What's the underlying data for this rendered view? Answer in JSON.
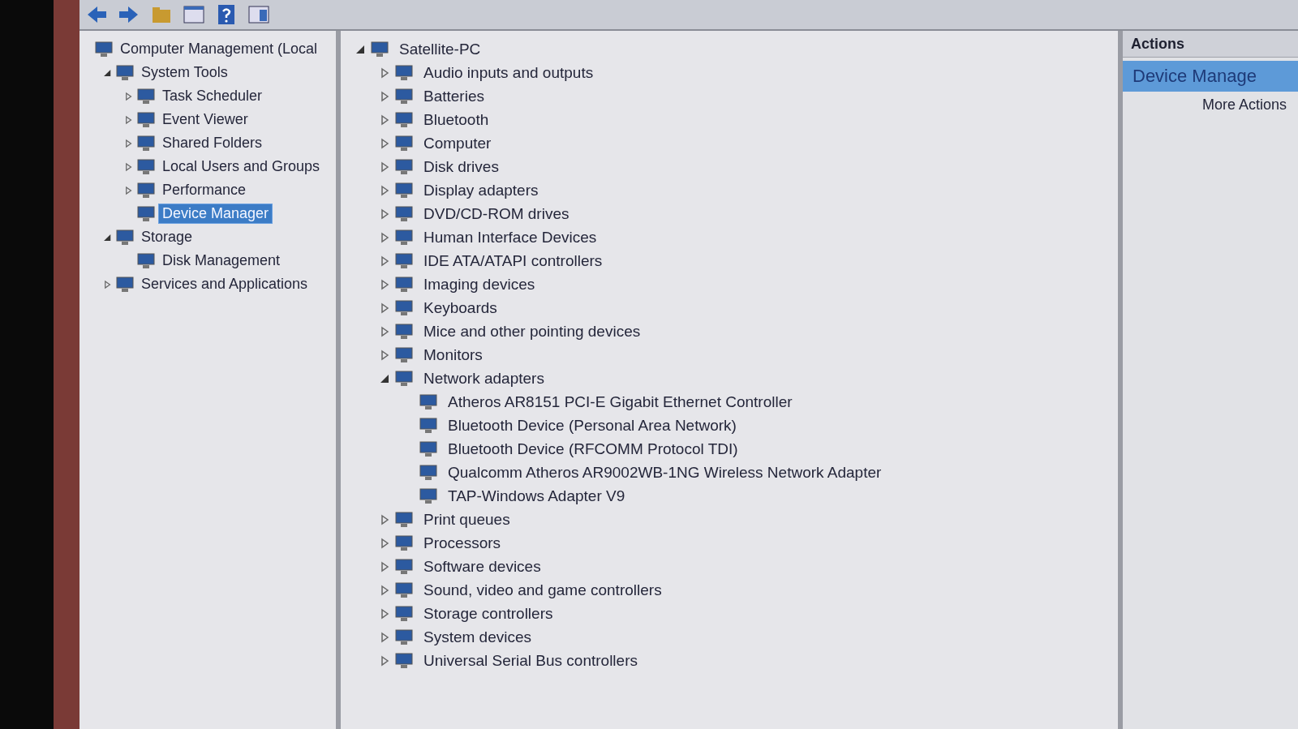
{
  "navigation_tree": [
    {
      "label": "Computer Management (Local",
      "children": [
        {
          "label": "System Tools",
          "expanded": true,
          "children": [
            {
              "label": "Task Scheduler",
              "expanded": false,
              "selected": false
            },
            {
              "label": "Event Viewer",
              "expanded": false,
              "selected": false
            },
            {
              "label": "Shared Folders",
              "expanded": false,
              "selected": false
            },
            {
              "label": "Local Users and Groups",
              "expanded": false,
              "selected": false
            },
            {
              "label": "Performance",
              "expanded": false,
              "selected": false
            },
            {
              "label": "Device Manager",
              "selected": true
            }
          ]
        },
        {
          "label": "Storage",
          "expanded": true,
          "children": [
            {
              "label": "Disk Management",
              "selected": false
            }
          ]
        },
        {
          "label": "Services and Applications",
          "expanded": false
        }
      ]
    }
  ],
  "device_tree": [
    {
      "label": "Satellite-PC",
      "expanded": true,
      "children": [
        {
          "label": "Audio inputs and outputs",
          "expanded": false
        },
        {
          "label": "Batteries",
          "expanded": false
        },
        {
          "label": "Bluetooth",
          "expanded": false
        },
        {
          "label": "Computer",
          "expanded": false
        },
        {
          "label": "Disk drives",
          "expanded": false
        },
        {
          "label": "Display adapters",
          "expanded": false
        },
        {
          "label": "DVD/CD-ROM drives",
          "expanded": false
        },
        {
          "label": "Human Interface Devices",
          "expanded": false
        },
        {
          "label": "IDE ATA/ATAPI controllers",
          "expanded": false
        },
        {
          "label": "Imaging devices",
          "expanded": false
        },
        {
          "label": "Keyboards",
          "expanded": false
        },
        {
          "label": "Mice and other pointing devices",
          "expanded": false
        },
        {
          "label": "Monitors",
          "expanded": false
        },
        {
          "label": "Network adapters",
          "expanded": true,
          "children": [
            {
              "label": "Atheros AR8151 PCI-E Gigabit Ethernet Controller"
            },
            {
              "label": "Bluetooth Device (Personal Area Network)"
            },
            {
              "label": "Bluetooth Device (RFCOMM Protocol TDI)"
            },
            {
              "label": "Qualcomm Atheros AR9002WB-1NG Wireless Network Adapter"
            },
            {
              "label": "TAP-Windows Adapter V9"
            }
          ]
        },
        {
          "label": "Print queues",
          "expanded": false
        },
        {
          "label": "Processors",
          "expanded": false
        },
        {
          "label": "Software devices",
          "expanded": false
        },
        {
          "label": "Sound, video and game controllers",
          "expanded": false
        },
        {
          "label": "Storage controllers",
          "expanded": false
        },
        {
          "label": "System devices",
          "expanded": false
        },
        {
          "label": "Universal Serial Bus controllers",
          "expanded": false
        }
      ]
    }
  ],
  "actions": {
    "title": "Actions",
    "items": [
      {
        "label": "Device Manage",
        "kind": "section",
        "selected": true
      },
      {
        "label": "More Actions",
        "kind": "link",
        "selected": false
      }
    ]
  }
}
